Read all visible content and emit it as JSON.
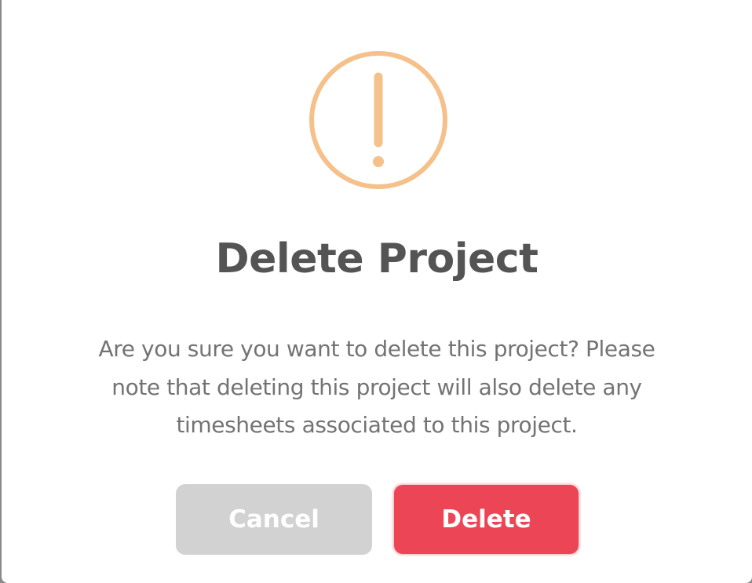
{
  "dialog": {
    "title": "Delete Project",
    "message": "Are you sure you want to delete this project? Please\nnote that deleting this project will also delete any\ntimesheets associated to this project.",
    "icon": "warning-exclamation-icon",
    "cancel_label": "Cancel",
    "delete_label": "Delete"
  },
  "colors": {
    "icon": "#f5c08a",
    "title": "#545454",
    "message": "#737373",
    "cancel_bg": "#d2d2d2",
    "delete_bg": "#ec4656"
  }
}
